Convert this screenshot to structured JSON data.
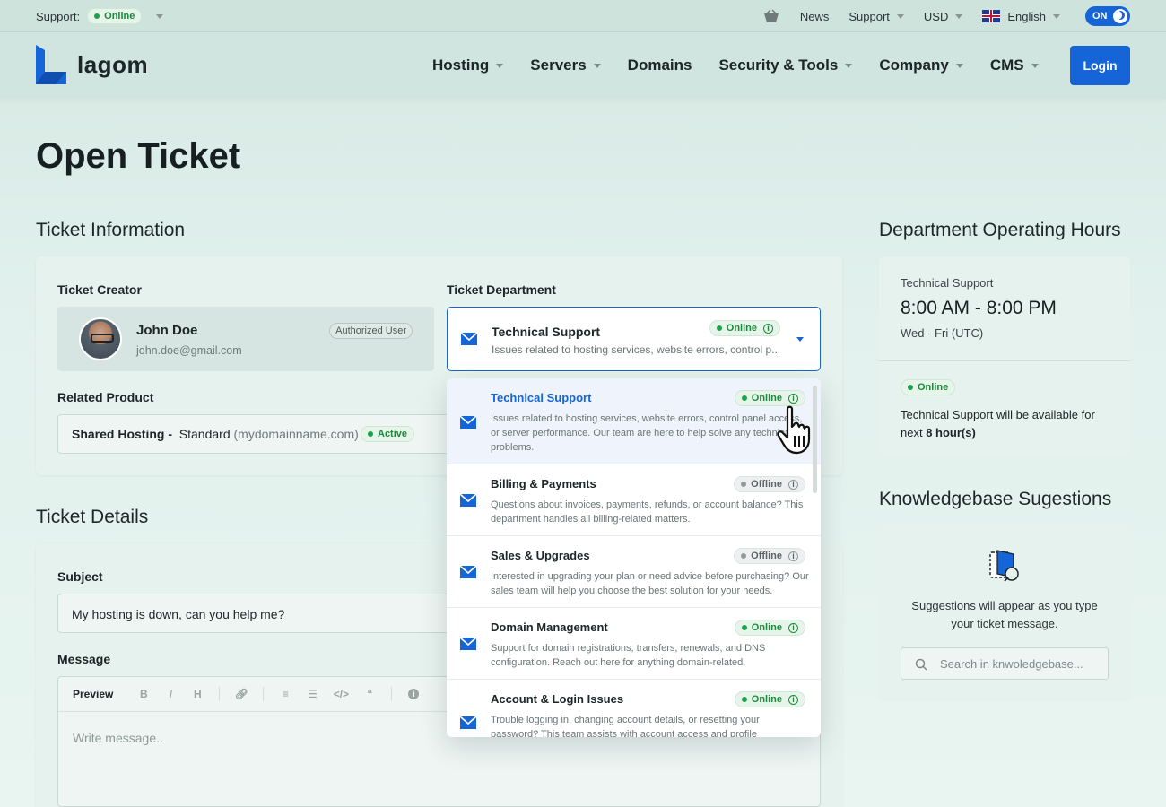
{
  "topbar": {
    "support_label": "Support:",
    "support_status": "Online",
    "news": "News",
    "support": "Support",
    "currency": "USD",
    "language": "English",
    "toggle": "ON"
  },
  "header": {
    "logo_text": "lagom",
    "nav": [
      "Hosting",
      "Servers",
      "Domains",
      "Security & Tools",
      "Company",
      "CMS"
    ],
    "login": "Login"
  },
  "page": {
    "title": "Open Ticket"
  },
  "ticket_info": {
    "section_title": "Ticket Information",
    "creator_label": "Ticket Creator",
    "creator_name": "John Doe",
    "creator_email": "john.doe@gmail.com",
    "creator_badge": "Authorized User",
    "related_label": "Related Product",
    "product_name": "Shared Hosting -",
    "product_plan": "Standard",
    "product_domain": "(mydomainname.com)",
    "product_status": "Active",
    "department_label": "Ticket Department",
    "selected_department": "Technical Support",
    "selected_status": "Online",
    "selected_desc": "Issues related to hosting services, website errors, control p..."
  },
  "departments": [
    {
      "title": "Technical Support",
      "status": "Online",
      "desc": "Issues related to hosting services, website errors, control panel access, or server performance. Our team are here to help solve any technical problems."
    },
    {
      "title": "Billing & Payments",
      "status": "Offline",
      "desc": "Questions about invoices, payments, refunds, or account balance? This department handles all billing-related matters."
    },
    {
      "title": "Sales & Upgrades",
      "status": "Offline",
      "desc": "Interested in upgrading your plan or need advice before purchasing? Our sales team will help you choose the best solution for your needs."
    },
    {
      "title": "Domain Management",
      "status": "Online",
      "desc": "Support for domain registrations, transfers, renewals, and DNS configuration. Reach out here for anything domain-related."
    },
    {
      "title": "Account & Login Issues",
      "status": "Online",
      "desc": "Trouble logging in, changing account details, or resetting your password? This team assists with account access and profile management."
    }
  ],
  "ticket_details": {
    "section_title": "Ticket Details",
    "subject_label": "Subject",
    "subject_value": "My hosting is down, can you help me?",
    "message_label": "Message",
    "preview": "Preview",
    "message_placeholder": "Write message.."
  },
  "hours": {
    "section_title": "Department Operating Hours",
    "department": "Technical Support",
    "time": "8:00 AM - 8:00 PM",
    "days": "Wed - Fri (UTC)",
    "status": "Online",
    "availability_text": "Technical Support will be available for next ",
    "availability_hours": "8 hour(s)"
  },
  "kb": {
    "section_title": "Knowledgebase Sugestions",
    "hint": "Suggestions will appear as you type your ticket message.",
    "search_placeholder": "Search in knwoledgebase..."
  },
  "colors": {
    "accent": "#1565d8",
    "online": "#1aa34a"
  }
}
